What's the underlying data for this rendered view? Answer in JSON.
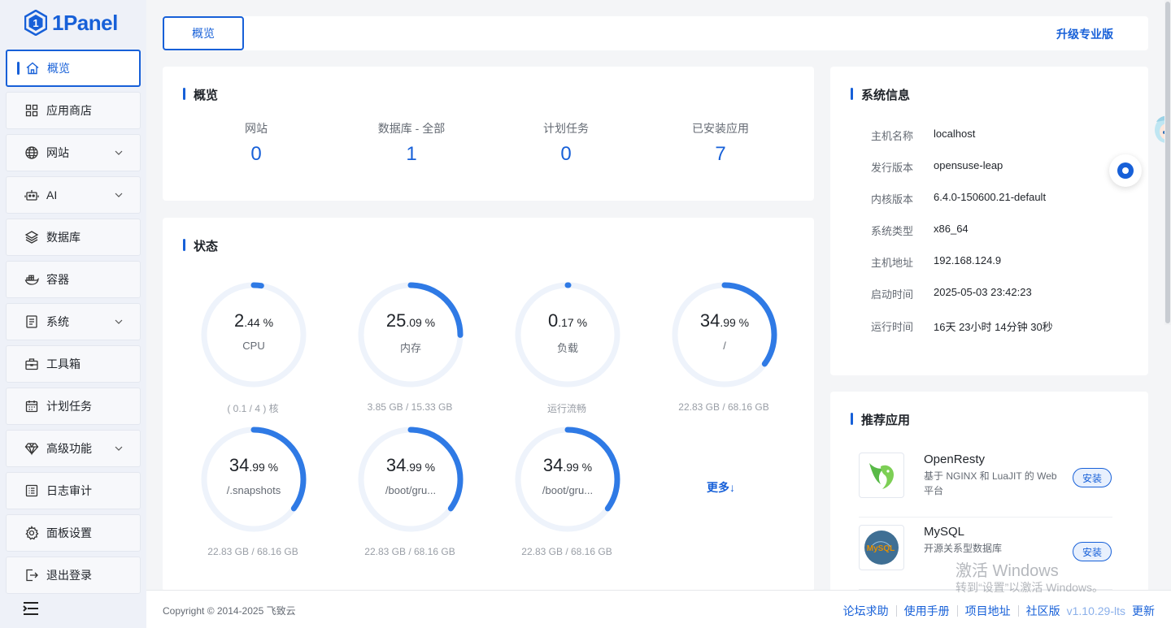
{
  "logo": {
    "text": "1Panel"
  },
  "nav": [
    {
      "label": "概览",
      "icon": "home-icon",
      "active": true
    },
    {
      "label": "应用商店",
      "icon": "grid-icon"
    },
    {
      "label": "网站",
      "icon": "globe-icon",
      "expandable": true
    },
    {
      "label": "AI",
      "icon": "robot-icon",
      "expandable": true
    },
    {
      "label": "数据库",
      "icon": "layers-icon"
    },
    {
      "label": "容器",
      "icon": "docker-icon"
    },
    {
      "label": "系统",
      "icon": "document-icon",
      "expandable": true
    },
    {
      "label": "工具箱",
      "icon": "toolbox-icon"
    },
    {
      "label": "计划任务",
      "icon": "calendar-icon"
    },
    {
      "label": "高级功能",
      "icon": "diamond-icon",
      "expandable": true
    },
    {
      "label": "日志审计",
      "icon": "list-icon"
    },
    {
      "label": "面板设置",
      "icon": "gear-icon"
    },
    {
      "label": "退出登录",
      "icon": "logout-icon"
    }
  ],
  "topbar": {
    "tab": "概览",
    "upgrade": "升级专业版"
  },
  "overview": {
    "title": "概览",
    "stats": [
      {
        "label": "网站",
        "value": "0"
      },
      {
        "label": "数据库 - 全部",
        "value": "1"
      },
      {
        "label": "计划任务",
        "value": "0"
      },
      {
        "label": "已安装应用",
        "value": "7"
      }
    ]
  },
  "status": {
    "title": "状态",
    "gauges": [
      {
        "int": "2",
        "dec": ".44 %",
        "name": "CPU",
        "sub": "( 0.1 / 4 ) 核",
        "percent": 2.44
      },
      {
        "int": "25",
        "dec": ".09 %",
        "name": "内存",
        "sub": "3.85 GB / 15.33 GB",
        "percent": 25.09
      },
      {
        "int": "0",
        "dec": ".17 %",
        "name": "负载",
        "sub": "运行流畅",
        "percent": 0.17
      },
      {
        "int": "34",
        "dec": ".99 %",
        "name": "/",
        "sub": "22.83 GB / 68.16 GB",
        "percent": 34.99
      },
      {
        "int": "34",
        "dec": ".99 %",
        "name": "/.snapshots",
        "sub": "22.83 GB / 68.16 GB",
        "percent": 34.99
      },
      {
        "int": "34",
        "dec": ".99 %",
        "name": "/boot/gru...",
        "sub": "22.83 GB / 68.16 GB",
        "percent": 34.99
      },
      {
        "int": "34",
        "dec": ".99 %",
        "name": "/boot/gru...",
        "sub": "22.83 GB / 68.16 GB",
        "percent": 34.99
      }
    ],
    "more": "更多↓"
  },
  "sysinfo": {
    "title": "系统信息",
    "rows": [
      {
        "k": "主机名称",
        "v": "localhost"
      },
      {
        "k": "发行版本",
        "v": "opensuse-leap"
      },
      {
        "k": "内核版本",
        "v": "6.4.0-150600.21-default"
      },
      {
        "k": "系统类型",
        "v": "x86_64"
      },
      {
        "k": "主机地址",
        "v": "192.168.124.9"
      },
      {
        "k": "启动时间",
        "v": "2025-05-03 23:42:23"
      },
      {
        "k": "运行时间",
        "v": "16天 23小时 14分钟 30秒"
      }
    ]
  },
  "recommend": {
    "title": "推荐应用",
    "apps": [
      {
        "name": "OpenResty",
        "desc": "基于 NGINX 和 LuaJIT 的 Web 平台",
        "action": "安装",
        "icon": "openresty-logo"
      },
      {
        "name": "MySQL",
        "desc": "开源关系型数据库",
        "action": "安装",
        "icon": "mysql-logo",
        "logo_text": "MySQL"
      }
    ]
  },
  "footer": {
    "copyright": "Copyright © 2014-2025 飞致云",
    "links": [
      "论坛求助",
      "使用手册",
      "项目地址",
      "社区版"
    ],
    "version": "v1.10.29-lts",
    "update": "更新"
  },
  "watermark": {
    "line1": "激活 Windows",
    "line2": "转到“设置”以激活 Windows。"
  },
  "colors": {
    "primary": "#1760d8",
    "sidebar_bg": "#eef1f8",
    "page_bg": "#f4f5f7"
  }
}
